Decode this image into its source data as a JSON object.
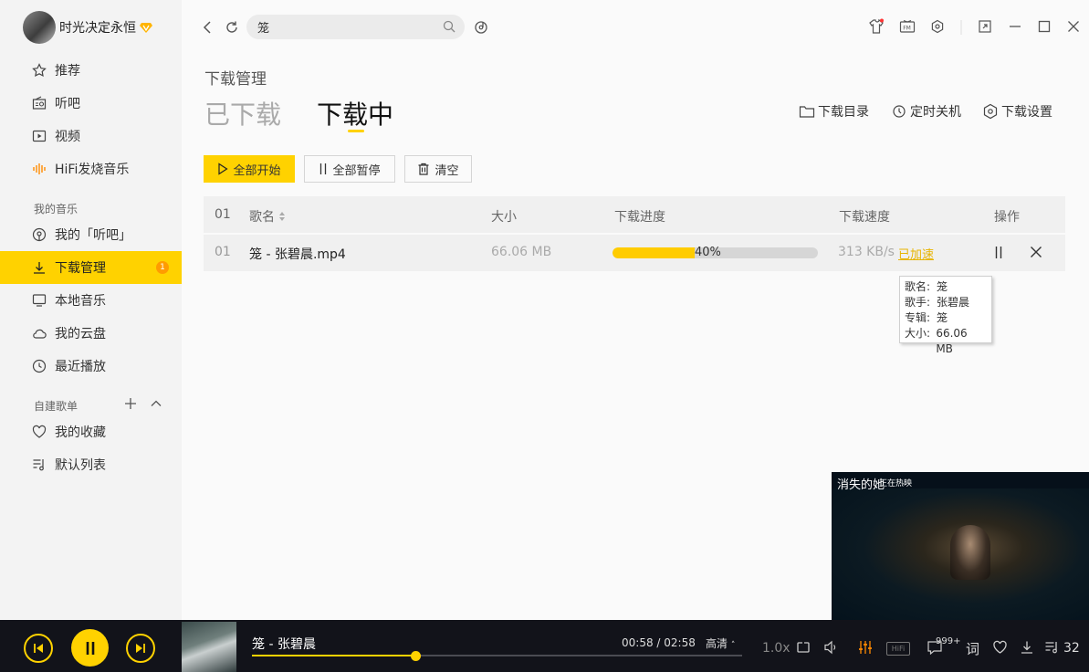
{
  "user": {
    "name": "时光决定永恒"
  },
  "sidebar": {
    "items": [
      {
        "label": "推荐"
      },
      {
        "label": "听吧"
      },
      {
        "label": "视频"
      },
      {
        "label": "HiFi发烧音乐"
      }
    ],
    "my_music_title": "我的音乐",
    "my_music": [
      {
        "label": "我的「听吧」"
      },
      {
        "label": "下载管理",
        "badge": "1"
      },
      {
        "label": "本地音乐"
      },
      {
        "label": "我的云盘"
      },
      {
        "label": "最近播放"
      }
    ],
    "playlists_title": "自建歌单",
    "playlists": [
      {
        "label": "我的收藏"
      },
      {
        "label": "默认列表"
      }
    ]
  },
  "search": {
    "value": "笼"
  },
  "main": {
    "title": "下载管理",
    "tab_done": "已下载",
    "tab_doing": "下载中",
    "actions": {
      "dir": "下载目录",
      "timer": "定时关机",
      "settings": "下载设置"
    },
    "buttons": {
      "start_all": "全部开始",
      "pause_all": "全部暂停",
      "clear": "清空"
    },
    "table": {
      "headers": {
        "index": "01",
        "name": "歌名",
        "size": "大小",
        "progress": "下载进度",
        "speed": "下载速度",
        "ops": "操作"
      },
      "rows": [
        {
          "index": "01",
          "name": "笼 - 张碧晨.mp4",
          "size": "66.06 MB",
          "progress": 0.4,
          "progress_label": "40%",
          "speed": "313 KB/s",
          "accel": "已加速"
        }
      ]
    },
    "tooltip": [
      {
        "k": "歌名:",
        "v": "笼"
      },
      {
        "k": "歌手:",
        "v": "张碧晨"
      },
      {
        "k": "专辑:",
        "v": "笼"
      },
      {
        "k": "大小:",
        "v": "66.06 MB"
      }
    ]
  },
  "video": {
    "title": "消失的她",
    "subtitle": "正在热映"
  },
  "player": {
    "song": "笼 - 张碧晨",
    "time": "00:58 / 02:58",
    "quality": "高清",
    "speed": "1.0x",
    "hifi": "HiFi",
    "comments": "999+",
    "lyrics": "词",
    "queue_count": "32",
    "progress": 0.33
  },
  "colors": {
    "accent": "#ffd200",
    "badge": "#ff9c00",
    "accel": "#e7b400",
    "player_bg": "#12131a"
  }
}
